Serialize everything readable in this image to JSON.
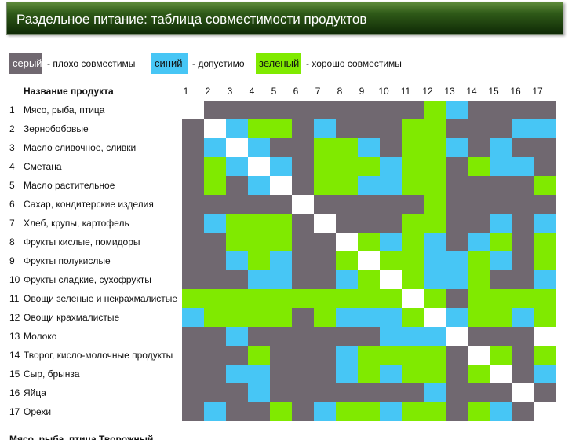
{
  "title": "Раздельное питание: таблица совместимости продуктов",
  "legend": [
    {
      "key": "g",
      "label": "серый",
      "desc": "- плохо совместимы",
      "color": "#706870"
    },
    {
      "key": "b",
      "label": "синий",
      "desc": "- допустимо",
      "color": "#47c6f5"
    },
    {
      "key": "v",
      "label": "зеленый",
      "desc": "- хорошо совместимы",
      "color": "#80ea00"
    }
  ],
  "diag_color": "#ffffff",
  "header": {
    "name": "Название продукта"
  },
  "columns": [
    "1",
    "2",
    "3",
    "4",
    "5",
    "6",
    "7",
    "8",
    "9",
    "10",
    "11",
    "12",
    "13",
    "14",
    "15",
    "16",
    "17"
  ],
  "products": [
    "Мясо, рыба, птица",
    "Зернобобовые",
    "Масло сливочное, сливки",
    "Сметана",
    "Масло растительное",
    "Сахар, кондитерские изделия",
    "Хлеб, крупы, картофель",
    "Фрукты кислые, помидоры",
    "Фрукты полукислые",
    "Фрукты сладкие, сухофрукты",
    "Овощи зеленые и некрахмалистые",
    "Овощи крахмалистые",
    "Молоко",
    "Творог, кисло-молочные продукты",
    "Сыр, брынза",
    "Яйца",
    "Орехи"
  ],
  "matrix": [
    "Wggggggggggvbgggggg",
    "gWbvvgbgggvvgggbb",
    "gbWbggvvbgvvbgbgg",
    "gvbWbgvvvbvvgvbbg",
    "gvgbWgvvbbvvggggv",
    "gggggWgggggvgggggg",
    "gbvvvgWgggvvggbgb",
    "ggvvvggWvbvbgbvgv",
    "ggbvbggvWvvbbvbgv",
    "gggbbggbvWvbbvggb",
    "vvvvvvvvvvWvgvvvv",
    "bvvvvgvbbbvWbvvbv",
    "ggbggggggbbbWggg",
    "gggvgggbvvvvgWvgv",
    "ggbbgggbvbvvgvWgb",
    "gggbgggggggbgggWg",
    "gbggvgbvvbvvgvbgW"
  ],
  "footer": "Мясо, рыба, птица                          Творожный"
}
